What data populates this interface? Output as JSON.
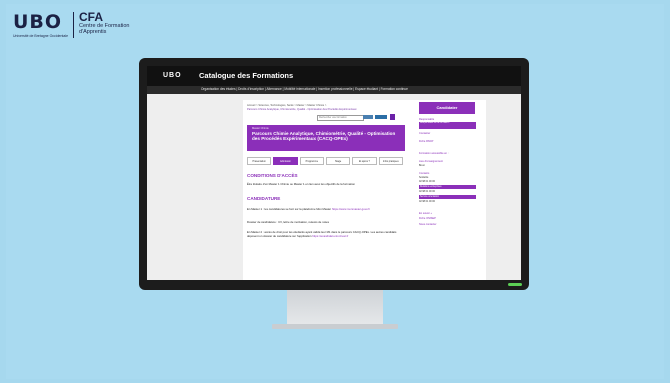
{
  "branding": {
    "ubo_word": "UBO",
    "ubo_sub": "Université de Bretagne Occidentale",
    "cfa_title": "CFA",
    "cfa_line1": "Centre de Formation",
    "cfa_line2": "d'Apprentis"
  },
  "screen": {
    "header_logo": "UBO",
    "header_title": "Catalogue des Formations",
    "nav": "Organisation des études | Droits d'inscription | Alternance | Mobilité internationale | Insertion professionnelle | Espace étudiant | Formation continue",
    "breadcrumb": "Accueil > Sciences, Technologies, Santé > Master > Master Chimie >",
    "breadcrumb2": "Parcours Chimie Analytique, Chimiométrie, Qualité - Optimisation des Procédés Expérimentaux",
    "search_placeholder": "Rechercher une formation",
    "hero_pre": "Master Chimie",
    "hero_title": "Parcours Chimie Analytique, Chimiométrie, Qualité - Optimisation des Procédés Expérimentaux (CACQ-OPEx)",
    "tabs": [
      {
        "label": "Présentation"
      },
      {
        "label": "Admission"
      },
      {
        "label": "Programme"
      },
      {
        "label": "Stage"
      },
      {
        "label": "Et après ?"
      },
      {
        "label": "Infos pratiques"
      }
    ],
    "conditions_title": "CONDITIONS D'ACCÈS",
    "conditions_text": "Être titulaire d'un Master 1 Chimie ou Master 1 en lien avec les objectifs de la formation",
    "candidature_title": "CANDIDATURE",
    "cand_p1a": "En Master 1 : les candidatures se font sur la plateforme Mon Master ",
    "cand_p1_link": "https://www.monmaster.gouv.fr",
    "cand_p2": "Dossier de candidature : CV, lettre de motivation, relevés de notes",
    "cand_p3a": "En Master 2 : accès de droit pour les étudiants ayant validé leur M1 dans le parcours CACQ-OPEx. Les autres candidats déposent un dossier de candidature sur l'application ",
    "cand_p3_link": "https://ecandidat.univ-brest.fr"
  },
  "sidebar": {
    "candidater": "Candidater",
    "label_responsable": "Responsable",
    "box1": "Responsable de la formation",
    "link_contact": "Contacter",
    "label_fiche": "Fiche RNCP",
    "label_formation": "Formation accessible en :",
    "label_lieu": "Lieu d'enseignement",
    "lieu": "Brest",
    "label_contacts": "Contacts",
    "box2": "Scolarité",
    "box2_detail": "02 98 01 00 00",
    "box3": "Relations entreprises",
    "box3_detail": "02 98 01 00 00",
    "box4": "Service orientation",
    "box4_detail": "02 98 01 00 00",
    "label_more": "En savoir +",
    "link_more": "Fiche ONISEP",
    "link_more2": "Nous contacter"
  }
}
